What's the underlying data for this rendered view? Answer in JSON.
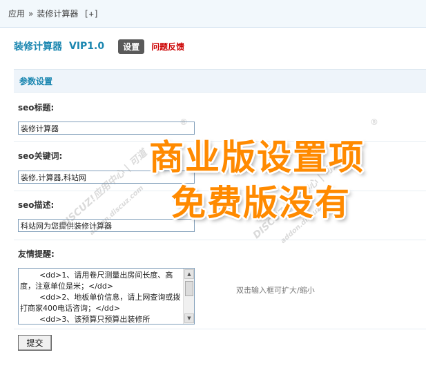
{
  "breadcrumb": {
    "root": "应用",
    "separator": "»",
    "current": "装修计算器",
    "add": "[+]"
  },
  "header": {
    "title": "装修计算器",
    "version": "VIP1.0",
    "settings_tab": "设置",
    "feedback_link": "问题反馈"
  },
  "section": {
    "title": "参数设置"
  },
  "fields": {
    "seo_title": {
      "label": "seo标题:",
      "value": "装修计算器"
    },
    "seo_keywords": {
      "label": "seo关键词:",
      "value": "装修,计算器,科站网"
    },
    "seo_description": {
      "label": "seo描述:",
      "value": "科站网为您提供装修计算器"
    },
    "tips": {
      "label": "友情提醒:",
      "value": "        <dd>1、请用卷尺测量出房间长度、高度，注意单位是米；</dd>\n        <dd>2、地板单价信息，请上网查询或拨打商家400电话咨询；</dd>\n        <dd>3、该预算只预算出装修所",
      "hint": "双击输入框可扩大/缩小"
    }
  },
  "submit_label": "提交",
  "overlay": {
    "line1": "商业版设置项",
    "line2": "免费版没有"
  },
  "watermark": {
    "text1": "DISCUZ!应用中心 | 可道",
    "text2": "addon.discuz.com",
    "registered": "®"
  }
}
